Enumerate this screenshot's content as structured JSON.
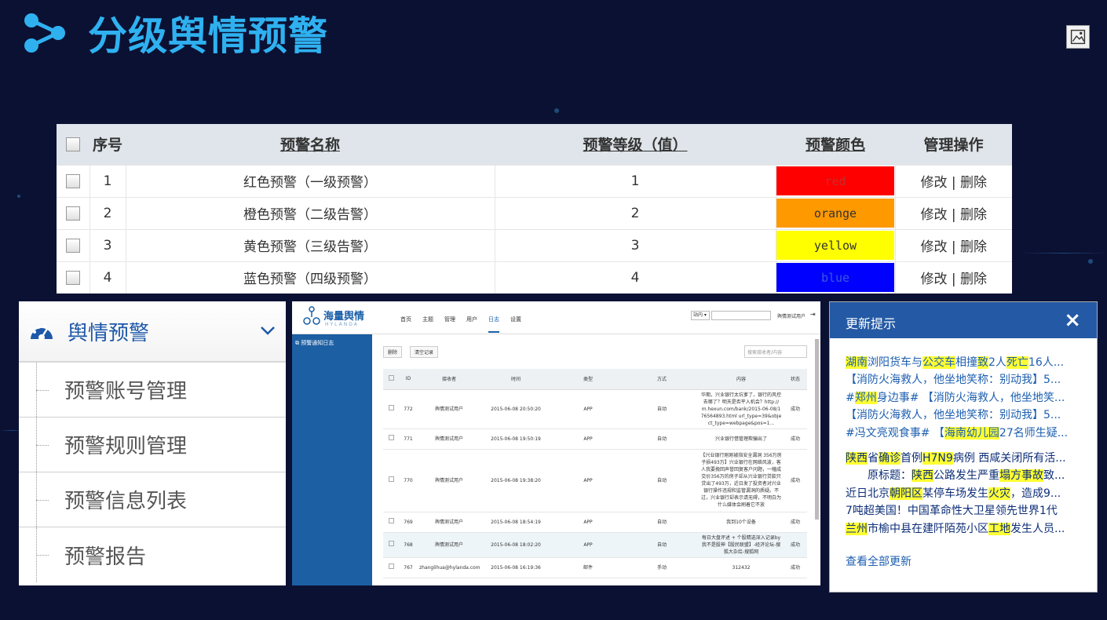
{
  "header": {
    "title": "分级舆情预警"
  },
  "table": {
    "columns": [
      "序号",
      "预警名称",
      "预警等级（值）",
      "预警颜色",
      "管理操作"
    ],
    "rows": [
      {
        "no": "1",
        "name": "红色预警（一级预警）",
        "level": "1",
        "color_label": "red",
        "color_hex": "#ff0000",
        "text_hex": "#c92b2b"
      },
      {
        "no": "2",
        "name": "橙色预警（二级告警）",
        "level": "2",
        "color_label": "orange",
        "color_hex": "#ff9900",
        "text_hex": "#333333"
      },
      {
        "no": "3",
        "name": "黄色预警（三级告警）",
        "level": "3",
        "color_label": "yellow",
        "color_hex": "#ffff00",
        "text_hex": "#333333"
      },
      {
        "no": "4",
        "name": "蓝色预警（四级预警）",
        "level": "4",
        "color_label": "blue",
        "color_hex": "#0000ff",
        "text_hex": "#3a58d8"
      }
    ],
    "edit_label": "修改",
    "sep": "|",
    "delete_label": "删除"
  },
  "menu": {
    "title": "舆情预警",
    "items": [
      "预警账号管理",
      "预警规则管理",
      "预警信息列表",
      "预警报告"
    ]
  },
  "app": {
    "brand": "海量舆情",
    "brand_sub": "HYLANDA",
    "nav": [
      "首页",
      "主题",
      "管理",
      "用户",
      "日志",
      "设置"
    ],
    "active_nav": "日志",
    "select": "站内",
    "user": "舆情测试用户",
    "sidebar_item": "预警通知日志",
    "delete_btn": "删除",
    "clear_btn": "清空记录",
    "search_placeholder": "搜索接收者/内容",
    "columns": [
      "ID",
      "接收者",
      "时间",
      "类型",
      "方式",
      "内容",
      "状态"
    ],
    "rows": [
      {
        "id": "772",
        "receiver": "舆情测试用户",
        "time": "2015-06-08 20:50:20",
        "type": "APP",
        "mode": "自动",
        "content": "华期，兴业银行太坑爹了，银行的风控去哪了？明天是否平入机会？http://m.hexun.com/bank/2015-06-08/176564893.html url_type=39&object_type=webpage&pos=1...",
        "status": "成功"
      },
      {
        "id": "771",
        "receiver": "舆情测试用户",
        "time": "2015-06-08 19:50:19",
        "type": "APP",
        "mode": "自动",
        "content": "兴业银行借管理欺骗出了",
        "status": "成功"
      },
      {
        "id": "770",
        "receiver": "舆情测试用户",
        "time": "2015-06-08 19:38:20",
        "type": "APP",
        "mode": "自动",
        "content": "【兴业银行刚刚被指安全漏洞 356万房子损493万】兴业银行在网络风波，客人我要挽回声誉回复客户问题，一幢成交价356万的房子却从兴业银行贷款只贷出了493万，近日发了投资者对兴业银行操作违规和监管漏洞的质疑。不过，兴业银行却表示请无碍，不明白为什么媒体会刷着它不放",
        "status": "成功"
      },
      {
        "id": "769",
        "receiver": "舆情测试用户",
        "time": "2015-06-08 18:54:19",
        "type": "APP",
        "mode": "自动",
        "content": "我到10个设备",
        "status": "成功"
      },
      {
        "id": "768",
        "receiver": "舆情测试用户",
        "time": "2015-06-08 18:02:20",
        "type": "APP",
        "mode": "自动",
        "content": "每日大盘评述 + 个股精选深入记录by我不是股神【股民联盟】-经济论坛-搜狐大杂烩-搜狐网",
        "status": "成功"
      },
      {
        "id": "767",
        "receiver": "zhanglihua@hylanda.com",
        "time": "2015-06-08 16:19:36",
        "type": "邮件",
        "mode": "手动",
        "content": "312432",
        "status": "成功"
      }
    ]
  },
  "updates": {
    "title": "更新提示",
    "close": "×",
    "group1": [
      [
        [
          "湖南",
          true
        ],
        [
          "浏阳货车与",
          false
        ],
        [
          "公交车",
          true
        ],
        [
          "相撞",
          false
        ],
        [
          "致",
          true
        ],
        [
          "2人",
          false
        ],
        [
          "死亡",
          true
        ],
        [
          "16人...",
          false
        ]
      ],
      [
        [
          "【消防火海救人，他坐地笑称：别动我】5...",
          false
        ]
      ],
      [
        [
          "#",
          false
        ],
        [
          "郑州",
          true
        ],
        [
          "身边事# 【消防火海救人，他坐地笑...",
          false
        ]
      ],
      [
        [
          "【消防火海救人，他坐地笑称：别动我】5...",
          false
        ]
      ],
      [
        [
          "#冯文亮观食事# 【",
          false
        ],
        [
          "海南幼儿园",
          true
        ],
        [
          "27名师生疑...",
          false
        ]
      ]
    ],
    "group2": [
      [
        [
          "陕西",
          true
        ],
        [
          "省",
          false
        ],
        [
          "确诊",
          true
        ],
        [
          "首例",
          false
        ],
        [
          "H7N9",
          true
        ],
        [
          "病例 西咸关闭所有活...",
          false
        ]
      ],
      [
        [
          "　　原标题：",
          false
        ],
        [
          "陕西",
          true
        ],
        [
          "公路发生严重",
          false
        ],
        [
          "塌方事故",
          true
        ],
        [
          "致...",
          false
        ]
      ],
      [
        [
          "近日北京",
          false
        ],
        [
          "朝阳区",
          true
        ],
        [
          "某停车场发生",
          false
        ],
        [
          "火灾",
          true
        ],
        [
          "，造成9...",
          false
        ]
      ],
      [
        [
          "7吨超美国！中国革命性大卫星领先世界1代",
          false
        ]
      ],
      [
        [
          "兰州",
          true
        ],
        [
          "市榆中县在建阡陌苑小区",
          false
        ],
        [
          "工地",
          true
        ],
        [
          "发生人员...",
          false
        ]
      ]
    ],
    "more": "查看全部更新"
  }
}
